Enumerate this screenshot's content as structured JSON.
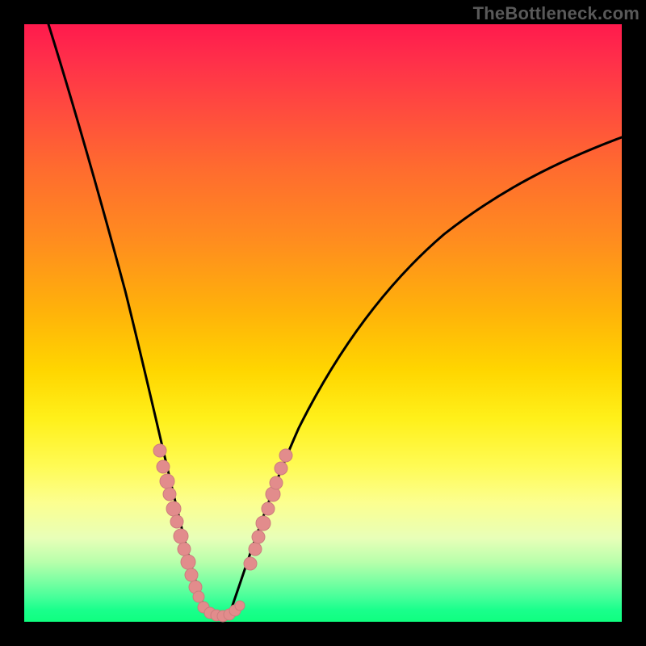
{
  "watermark": "TheBottleneck.com",
  "colors": {
    "frame": "#000000",
    "curve": "#000000",
    "bead": "#e28c8c",
    "gradient_top": "#ff1a4d",
    "gradient_bottom": "#0fff7f"
  },
  "chart_data": {
    "type": "line",
    "title": "",
    "xlabel": "",
    "ylabel": "",
    "xlim": [
      0,
      100
    ],
    "ylim": [
      0,
      100
    ],
    "grid": false,
    "legend": false,
    "description": "V-shaped bottleneck curve over red→green vertical gradient. Y axis appears to be bottleneck percentage (top=high, bottom=0). Minimum near x≈28.",
    "series": [
      {
        "name": "left-branch",
        "x": [
          4,
          6,
          8,
          10,
          12,
          14,
          16,
          18,
          20,
          22,
          24,
          26,
          27,
          28
        ],
        "y": [
          100,
          90,
          79,
          68,
          58,
          48,
          40,
          32,
          25,
          18,
          12,
          6,
          3,
          1
        ]
      },
      {
        "name": "right-branch",
        "x": [
          28,
          30,
          32,
          34,
          36,
          38,
          42,
          46,
          50,
          56,
          62,
          70,
          78,
          86,
          94,
          100
        ],
        "y": [
          1,
          3,
          7,
          12,
          18,
          24,
          34,
          42,
          49,
          56,
          62,
          68,
          73,
          77,
          80,
          82
        ]
      }
    ],
    "points": [
      {
        "name": "bead-cluster-left",
        "x": [
          19.0,
          19.5,
          20.5,
          20.8,
          21.5,
          22.0,
          22.5,
          23.0,
          23.5,
          24.0,
          24.5,
          24.8
        ],
        "y": [
          28,
          25,
          22,
          20,
          18,
          16,
          14,
          12,
          10,
          8,
          6,
          5
        ]
      },
      {
        "name": "bead-cluster-floor",
        "x": [
          25.5,
          26.5,
          27.5,
          28.5,
          29.5,
          30.5,
          31.0
        ],
        "y": [
          2,
          1,
          1,
          1,
          1,
          1,
          2
        ]
      },
      {
        "name": "bead-cluster-right",
        "x": [
          33.0,
          33.8,
          34.3,
          35.0,
          35.8,
          36.5,
          37.0,
          37.8,
          38.5
        ],
        "y": [
          10,
          12,
          14,
          17,
          19,
          22,
          24,
          26,
          28
        ]
      }
    ]
  }
}
